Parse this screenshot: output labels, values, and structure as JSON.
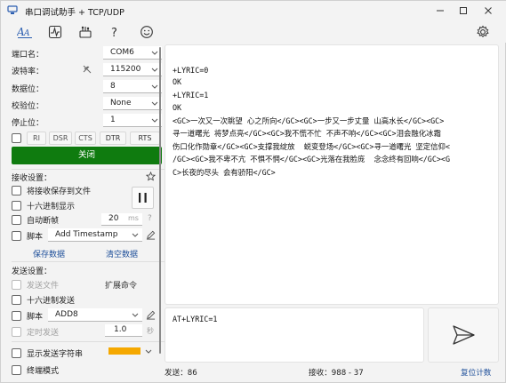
{
  "window": {
    "title": "串口调试助手 + TCP/UDP"
  },
  "toolbar": {
    "buttons": [
      "font-icon",
      "waveform-icon",
      "config-icon",
      "help-icon",
      "smiley-icon"
    ]
  },
  "serial": {
    "port_label": "端口名：",
    "port_value": "COM6",
    "baud_label": "波特率：",
    "baud_value": "115200",
    "databits_label": "数据位：",
    "databits_value": "8",
    "parity_label": "校验位：",
    "parity_value": "None",
    "stopbits_label": "停止位：",
    "stopbits_value": "1",
    "signals": [
      "RI",
      "DSR",
      "CTS",
      "DTR",
      "RTS"
    ],
    "close_label": "关闭"
  },
  "receive_settings": {
    "title": "接收设置：",
    "save_to_file": "将接收保存到文件",
    "hex_display": "十六进制显示",
    "auto_frame": "自动断帧",
    "frame_ms_value": "20",
    "frame_ms_unit": "ms",
    "frame_help": "?",
    "script_label": "脚本",
    "script_value": "Add Timestamp",
    "save_data": "保存数据",
    "clear_data": "清空数据"
  },
  "send_settings": {
    "title": "发送设置：",
    "send_file": "发送文件",
    "expand_cmd": "扩展命令",
    "hex_send": "十六进制发送",
    "script_label": "脚本",
    "script_value": "ADD8",
    "timed_send": "定时发送",
    "timed_value": "1.0",
    "timed_unit": "秒",
    "show_send_str": "显示发送字符串",
    "terminal_mode": "终端模式"
  },
  "receive_lines": [
    "+LYRIC=0",
    "OK",
    "+LYRIC=1",
    "OK",
    "<GC>一次又一次眺望 心之所向</GC><GC>一步又一步丈量 山高水长</GC><GC>",
    "寻一道曙光 将梦点亮</GC><GC>我不慌不忙 不声不响</GC><GC>泪会融化冰霜",
    "伤口化作勋章</GC><GC>支撑我绽放  蜕变登场</GC><GC>寻一道曙光 坚定信仰<",
    "/GC><GC>我不卑不亢 不惧不惘</GC><GC>光落在我脸庞  念念终有回响</GC><G",
    "C>长夜的尽头 会有骄阳</GC>"
  ],
  "send_input": "AT+LYRIC=1",
  "status": {
    "sent": "发送：86",
    "received": "接收：988 - 37",
    "reset": "复位计数"
  },
  "colors": {
    "accent_green": "#0f7b0f",
    "color_swatch": "#f5a800",
    "link": "#1e4f9a"
  }
}
